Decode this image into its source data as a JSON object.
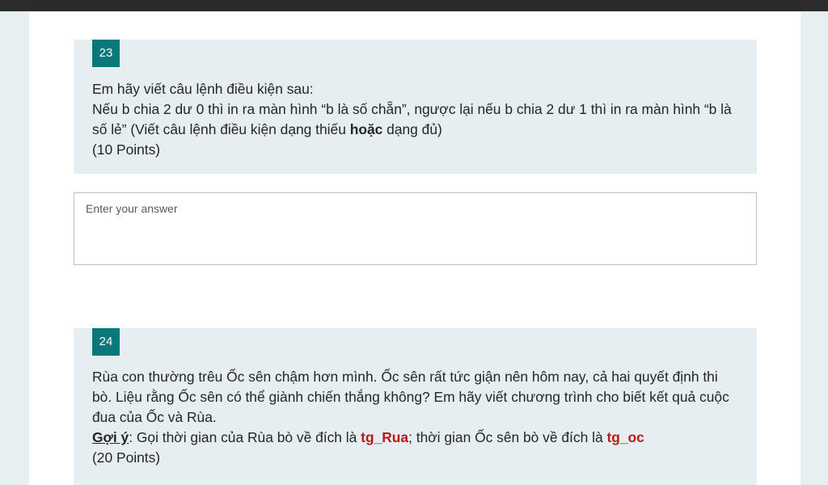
{
  "questions": [
    {
      "number": "23",
      "line1": "Em hãy viết câu lệnh điều kiện sau:",
      "line2": " Nếu b chia 2 dư 0 thì in ra màn hình “b là số chẵn”, ngược lại nếu b chia 2 dư 1 thì in ra màn hình “b là số lẻ” (Viết câu lệnh điều kiện dạng thiếu ",
      "line2_bold": "hoặc",
      "line2_end": " dạng đủ)",
      "points": "(10 Points)"
    },
    {
      "number": "24",
      "body": "Rùa con thường trêu Ốc sên chậm hơn mình. Ốc sên rất tức giận nên hôm nay, cả hai quyết định thi bò. Liệu rằng Ốc sên có thể giành chiến thắng không? Em hãy viết chương trình cho biết kết quả cuộc đua của Ốc  và  Rùa.",
      "hint_label": "Gợi ý",
      "hint_colon": ": Gọi thời gian của Rùa bò về đích là ",
      "var1": "tg_Rua",
      "hint_mid": "; thời gian Ốc sên bò về đích là ",
      "var2": "tg_oc",
      "points": "(20 Points)"
    }
  ],
  "answer": {
    "placeholder": "Enter your answer",
    "value": ""
  },
  "colors": {
    "number_badge": "#08787b",
    "question_bg": "#e6eef1",
    "highlight_red": "#b61a1a"
  }
}
